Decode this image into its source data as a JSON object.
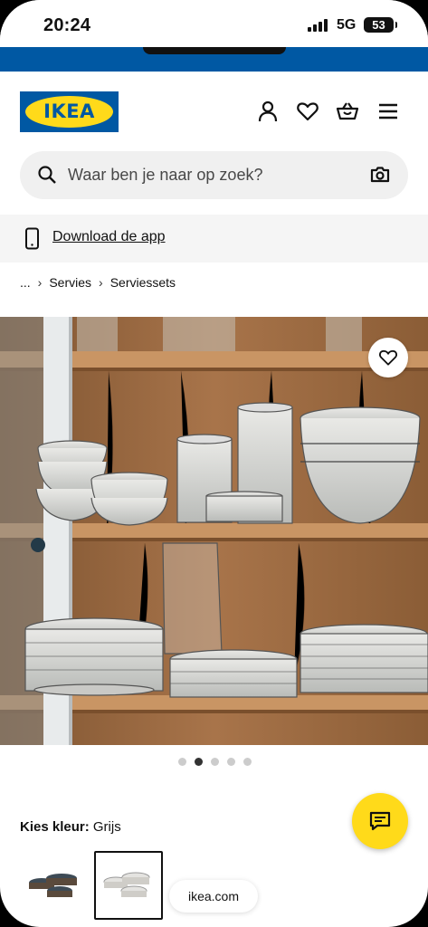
{
  "status_bar": {
    "time": "20:24",
    "network": "5G",
    "battery": "53"
  },
  "header": {
    "logo_text": "IKEA"
  },
  "search": {
    "placeholder": "Waar ben je naar op zoek?"
  },
  "download_app": {
    "label": "Download de app"
  },
  "breadcrumb": {
    "ellipsis": "...",
    "items": [
      "Servies",
      "Serviessets"
    ]
  },
  "product_gallery": {
    "slide_count": 5,
    "active_slide": 2
  },
  "colour_picker": {
    "label": "Kies kleur:",
    "selected": "Grijs"
  },
  "browser": {
    "url": "ikea.com"
  },
  "colors": {
    "ikea_blue": "#0058a3",
    "ikea_yellow": "#ffda1a"
  },
  "icons": [
    "account-icon",
    "heart-icon",
    "basket-icon",
    "menu-icon",
    "search-icon",
    "camera-icon",
    "phone-icon",
    "chat-icon"
  ]
}
